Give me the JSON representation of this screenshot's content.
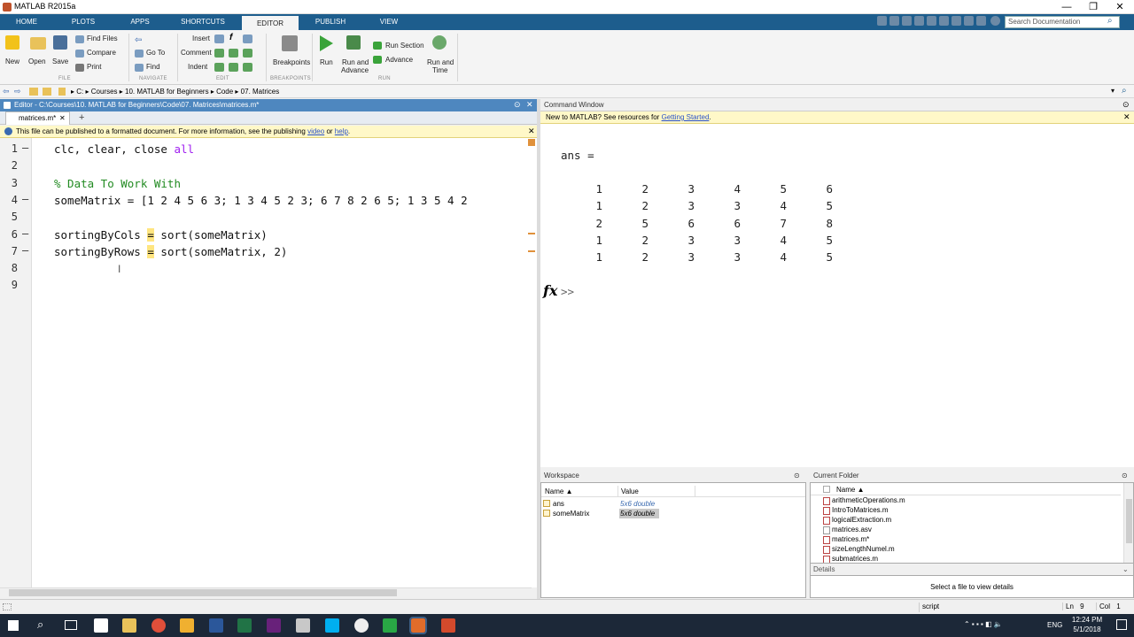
{
  "window": {
    "title": "MATLAB R2015a",
    "min": "—",
    "max": "❐",
    "close": "✕"
  },
  "tabs": [
    "HOME",
    "PLOTS",
    "APPS",
    "SHORTCUTS",
    "EDITOR",
    "PUBLISH",
    "VIEW"
  ],
  "active_tab": "EDITOR",
  "search_placeholder": "Search Documentation",
  "ribbon": {
    "new": "New",
    "open": "Open",
    "save": "Save",
    "find_files": "Find Files",
    "compare": "Compare",
    "print": "Print",
    "go_to": "Go To",
    "find": "Find",
    "insert": "Insert",
    "comment": "Comment",
    "indent": "Indent",
    "breakpoints": "Breakpoints",
    "run": "Run",
    "run_and_advance_1": "Run and",
    "run_and_advance_2": "Advance",
    "run_section": "Run Section",
    "advance": "Advance",
    "run_and_time_1": "Run and",
    "run_and_time_2": "Time",
    "groups": {
      "file": "FILE",
      "navigate": "NAVIGATE",
      "edit": "EDIT",
      "breakpoints": "BREAKPOINTS",
      "run": "RUN"
    }
  },
  "address": {
    "parts": [
      "C:",
      "Courses",
      "10. MATLAB for Beginners",
      "Code",
      "07. Matrices"
    ]
  },
  "editor": {
    "header": "Editor - C:\\Courses\\10. MATLAB for Beginners\\Code\\07. Matrices\\matrices.m*",
    "tab": "matrices.m*",
    "notice_text": "This file can be published to a formatted document. For more information, see the publishing",
    "notice_video": "video",
    "notice_or": "or",
    "notice_help": "help",
    "notice_end": ".",
    "line_numbers": [
      "1",
      "2",
      "3",
      "4",
      "5",
      "6",
      "7",
      "8",
      "9"
    ],
    "line1_a": "clc, clear, close ",
    "line1_b": "all",
    "line3": "% Data To Work With",
    "line4": "someMatrix = [1 2 4 5 6 3; 1 3 4 5 2 3; 6 7 8 2 6 5; 1 3 5 4 2",
    "line6_a": "sortingByCols ",
    "line6_eq": "=",
    "line6_b": " sort(someMatrix)",
    "line7_a": "sortingByRows ",
    "line7_eq": "=",
    "line7_b": " sort(someMatrix, 2)"
  },
  "command": {
    "header": "Command Window",
    "notice_text": "New to MATLAB? See resources for",
    "notice_link": "Getting Started",
    "notice_end": ".",
    "ans_label": "ans =",
    "matrix": [
      [
        "1",
        "2",
        "3",
        "4",
        "5",
        "6"
      ],
      [
        "1",
        "2",
        "3",
        "3",
        "4",
        "5"
      ],
      [
        "2",
        "5",
        "6",
        "6",
        "7",
        "8"
      ],
      [
        "1",
        "2",
        "3",
        "3",
        "4",
        "5"
      ],
      [
        "1",
        "2",
        "3",
        "3",
        "4",
        "5"
      ]
    ],
    "fx": "fx",
    "prompt": ">>"
  },
  "workspace": {
    "header": "Workspace",
    "col_name": "Name ▲",
    "col_value": "Value",
    "rows": [
      {
        "name": "ans",
        "value": "5x6 double"
      },
      {
        "name": "someMatrix",
        "value": "5x6 double"
      }
    ]
  },
  "current_folder": {
    "header": "Current Folder",
    "col_name": "Name ▲",
    "files": [
      "arithmeticOperations.m",
      "IntroToMatrices.m",
      "logicalExtraction.m",
      "matrices.asv",
      "matrices.m*",
      "sizeLengthNumel.m",
      "submatrices.m"
    ],
    "details": "Details",
    "details_text": "Select a file to view details"
  },
  "status": {
    "mode": "script",
    "ln_label": "Ln",
    "ln": "9",
    "col_label": "Col",
    "col": "1"
  },
  "taskbar": {
    "lang": "ENG",
    "time": "12:24 PM",
    "date": "5/1/2018"
  }
}
